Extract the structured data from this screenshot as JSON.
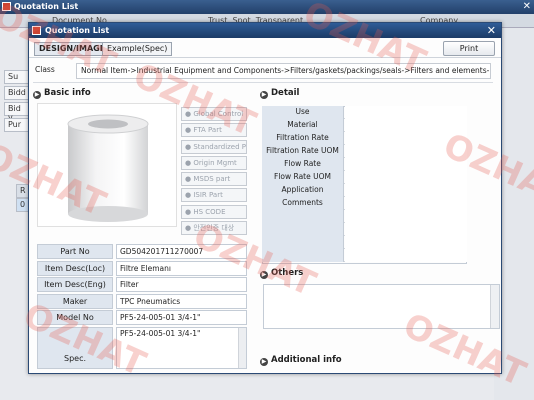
{
  "background": {
    "title": "Quotation List",
    "columns": [
      "Document No",
      "Trust, Spot, Transparent",
      "Company"
    ],
    "left_labels": [
      "Su",
      "Bidd",
      "Bid v",
      "Pur"
    ],
    "table_marks": [
      "R",
      "0"
    ]
  },
  "dialog": {
    "title": "Quotation List",
    "tabs": [
      "DESIGN/IMAGE",
      "Example(Spec)"
    ],
    "print_label": "Print",
    "class_label": "Class",
    "class_value": "Normal Item->Industrial Equipment and Components->Filters/gaskets/packings/seals->Filters and elements->",
    "basic_info_title": "Basic info",
    "detail_title": "Detail",
    "others_title": "Others",
    "additional_title": "Additional info",
    "side_buttons": [
      "Global Control L",
      "FTA Part",
      "Standardized P",
      "Origin Mgmt",
      "MSDS part",
      "ISIR Part",
      "HS CODE",
      "안전인증 대상"
    ],
    "info": [
      {
        "label": "Part No",
        "value": "GD504201711270007"
      },
      {
        "label": "Item Desc(Loc)",
        "value": "Filtre Elemanı"
      },
      {
        "label": "Item Desc(Eng)",
        "value": "Filter"
      },
      {
        "label": "Maker",
        "value": "TPC Pneumatics"
      },
      {
        "label": "Model No",
        "value": "PF5-24-005-01  3/4-1\""
      }
    ],
    "spec_label": "Spec.",
    "spec_value": "PF5-24-005-01  3/4-1\"",
    "detail_rows": [
      "Use",
      "Material",
      "Filtration Rate",
      "Filtration Rate UOM",
      "Flow Rate",
      "Flow Rate UOM",
      "Application",
      "Comments",
      "",
      "",
      "",
      ""
    ]
  },
  "watermark": "OZHAT"
}
